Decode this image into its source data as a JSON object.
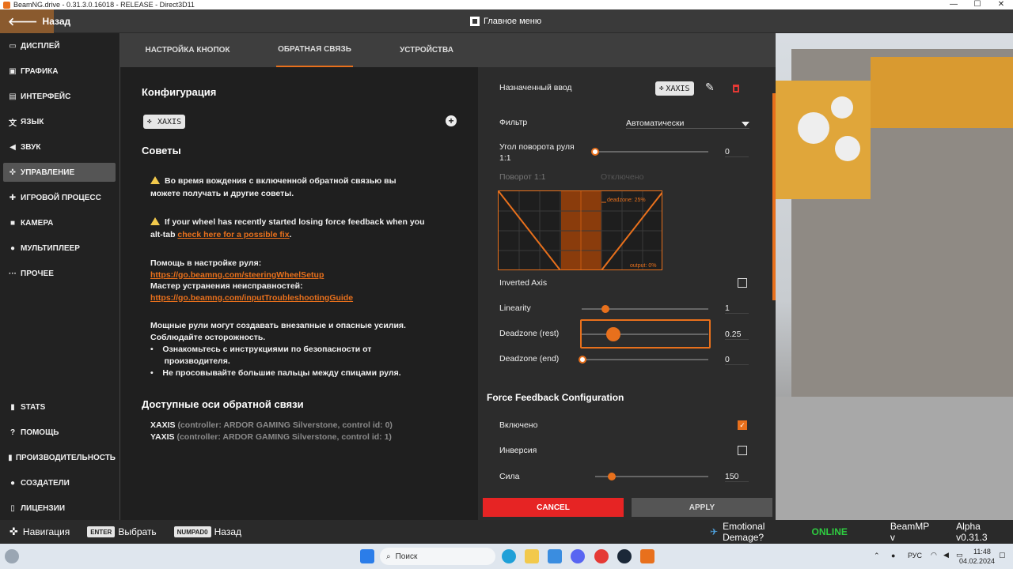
{
  "window": {
    "title": "BeamNG.drive - 0.31.3.0.16018 - RELEASE - Direct3D11",
    "minimize": "—",
    "maximize": "☐",
    "close": "✕"
  },
  "topbar": {
    "back_label": "Назад",
    "main_menu_label": "Главное меню"
  },
  "sidebar": {
    "items": [
      {
        "label": "ДИСПЛЕЙ",
        "icon": "monitor-icon"
      },
      {
        "label": "ГРАФИКА",
        "icon": "image-icon"
      },
      {
        "label": "ИНТЕРФЕЙС",
        "icon": "interface-icon"
      },
      {
        "label": "ЯЗЫК",
        "icon": "translate-icon"
      },
      {
        "label": "ЗВУК",
        "icon": "speaker-icon"
      },
      {
        "label": "УПРАВЛЕНИЕ",
        "icon": "gamepad-icon"
      },
      {
        "label": "ИГРОВОЙ ПРОЦЕСС",
        "icon": "puzzle-icon"
      },
      {
        "label": "КАМЕРА",
        "icon": "camera-icon"
      },
      {
        "label": "МУЛЬТИПЛЕЕР",
        "icon": "people-icon"
      },
      {
        "label": "ПРОЧЕЕ",
        "icon": "dots-icon"
      }
    ],
    "bottom_items": [
      {
        "label": "STATS",
        "icon": "bar-chart-icon"
      },
      {
        "label": "ПОМОЩЬ",
        "icon": "help-icon"
      },
      {
        "label": "ПРОИЗВОДИТЕЛЬНОСТЬ",
        "icon": "bar-chart-icon"
      },
      {
        "label": "СОЗДАТЕЛИ",
        "icon": "people-icon"
      },
      {
        "label": "ЛИЦЕНЗИИ",
        "icon": "document-icon"
      }
    ]
  },
  "tabs": [
    "НАСТРОЙКА КНОПОК",
    "ОБРАТНАЯ СВЯЗЬ",
    "УСТРОЙСТВА"
  ],
  "left": {
    "config_title": "Конфигурация",
    "config_chip": "XAXIS",
    "tips_title": "Советы",
    "tip1": "Во время вождения с включенной обратной связью вы",
    "tip1b": "можете получать и другие советы.",
    "tip2": "If your wheel has recently started losing force feedback when you",
    "tip2b_prefix": "alt-tab ",
    "tip2b_link": "check here for a possible fix",
    "tip2b_suffix": ".",
    "help_wheel": "Помощь в настройке руля:",
    "help_wheel_url": "https://go.beamng.com/steeringWheelSetup",
    "troubleshoot": "Мастер устранения неисправностей:",
    "troubleshoot_url": "https://go.beamng.com/inputTroubleshootingGuide",
    "safety1": "Мощные рули могут создавать внезапные и опасные усилия.",
    "safety2": "Соблюдайте осторожность.",
    "safety_b1a": "Ознакомьтесь с инструкциями по безопасности от",
    "safety_b1b": "производителя.",
    "safety_b2": "Не просовывайте большие пальцы между спицами руля.",
    "axes_title": "Доступные оси обратной связи",
    "axes": [
      {
        "name": "XAXIS",
        "detail": "(controller: ARDOR GAMING Silverstone, control id: 0)"
      },
      {
        "name": "YAXIS",
        "detail": "(controller: ARDOR GAMING Silverstone, control id: 1)"
      }
    ]
  },
  "right": {
    "assigned_input": "Назначенный ввод",
    "assigned_chip": "XAXIS",
    "filter_label": "Фильтр",
    "filter_value": "Автоматически",
    "steer_angle_label_1": "Угол поворота руля",
    "steer_angle_label_2": "1:1",
    "steer_angle_value": "0",
    "rotation_label": "Поворот 1:1",
    "rotation_state": "Отключено",
    "graph_deadzone": "deadzone: 25%",
    "graph_output": "output: 0%",
    "inverted_axis": "Inverted Axis",
    "linearity_label": "Linearity",
    "linearity_value": "1",
    "deadzone_rest_label": "Deadzone (rest)",
    "deadzone_rest_value": "0.25",
    "deadzone_end_label": "Deadzone (end)",
    "deadzone_end_value": "0",
    "ffb_title": "Force Feedback Configuration",
    "enabled_label": "Включено",
    "inversion_label": "Инверсия",
    "strength_label": "Сила",
    "strength_value": "150",
    "cancel": "CANCEL",
    "apply": "APPLY"
  },
  "bottombar": {
    "nav_label": "Навигация",
    "enter_key": "ENTER",
    "select_label": "Выбрать",
    "numpad_key": "NUMPAD0",
    "back_label": "Назад",
    "player_name": "Emotional Demage?",
    "online_status": "ONLINE",
    "beammp": "BeamMP v",
    "version": "Alpha v0.31.3"
  },
  "taskbar": {
    "search_placeholder": "Поиск",
    "lang": "РУС",
    "time": "11:48",
    "date": "04.02.2024"
  },
  "colors": {
    "accent": "#e8701c",
    "cancel": "#e62424",
    "online": "#2ecc40"
  }
}
